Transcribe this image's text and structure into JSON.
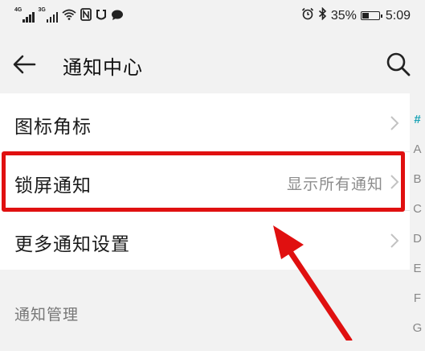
{
  "status_bar": {
    "signal1_tag": "4G",
    "signal2_tag": "3G",
    "battery": "35%",
    "time": "5:09"
  },
  "app_bar": {
    "title": "通知中心"
  },
  "list": {
    "items": [
      {
        "label": "图标角标",
        "value": ""
      },
      {
        "label": "锁屏通知",
        "value": "显示所有通知"
      },
      {
        "label": "更多通知设置",
        "value": ""
      }
    ]
  },
  "section": {
    "header": "通知管理"
  },
  "alpha_index": [
    "#",
    "A",
    "B",
    "C",
    "D",
    "E",
    "F",
    "G"
  ],
  "colors": {
    "accent": "#1aa3b5",
    "annotation": "#e01010"
  }
}
